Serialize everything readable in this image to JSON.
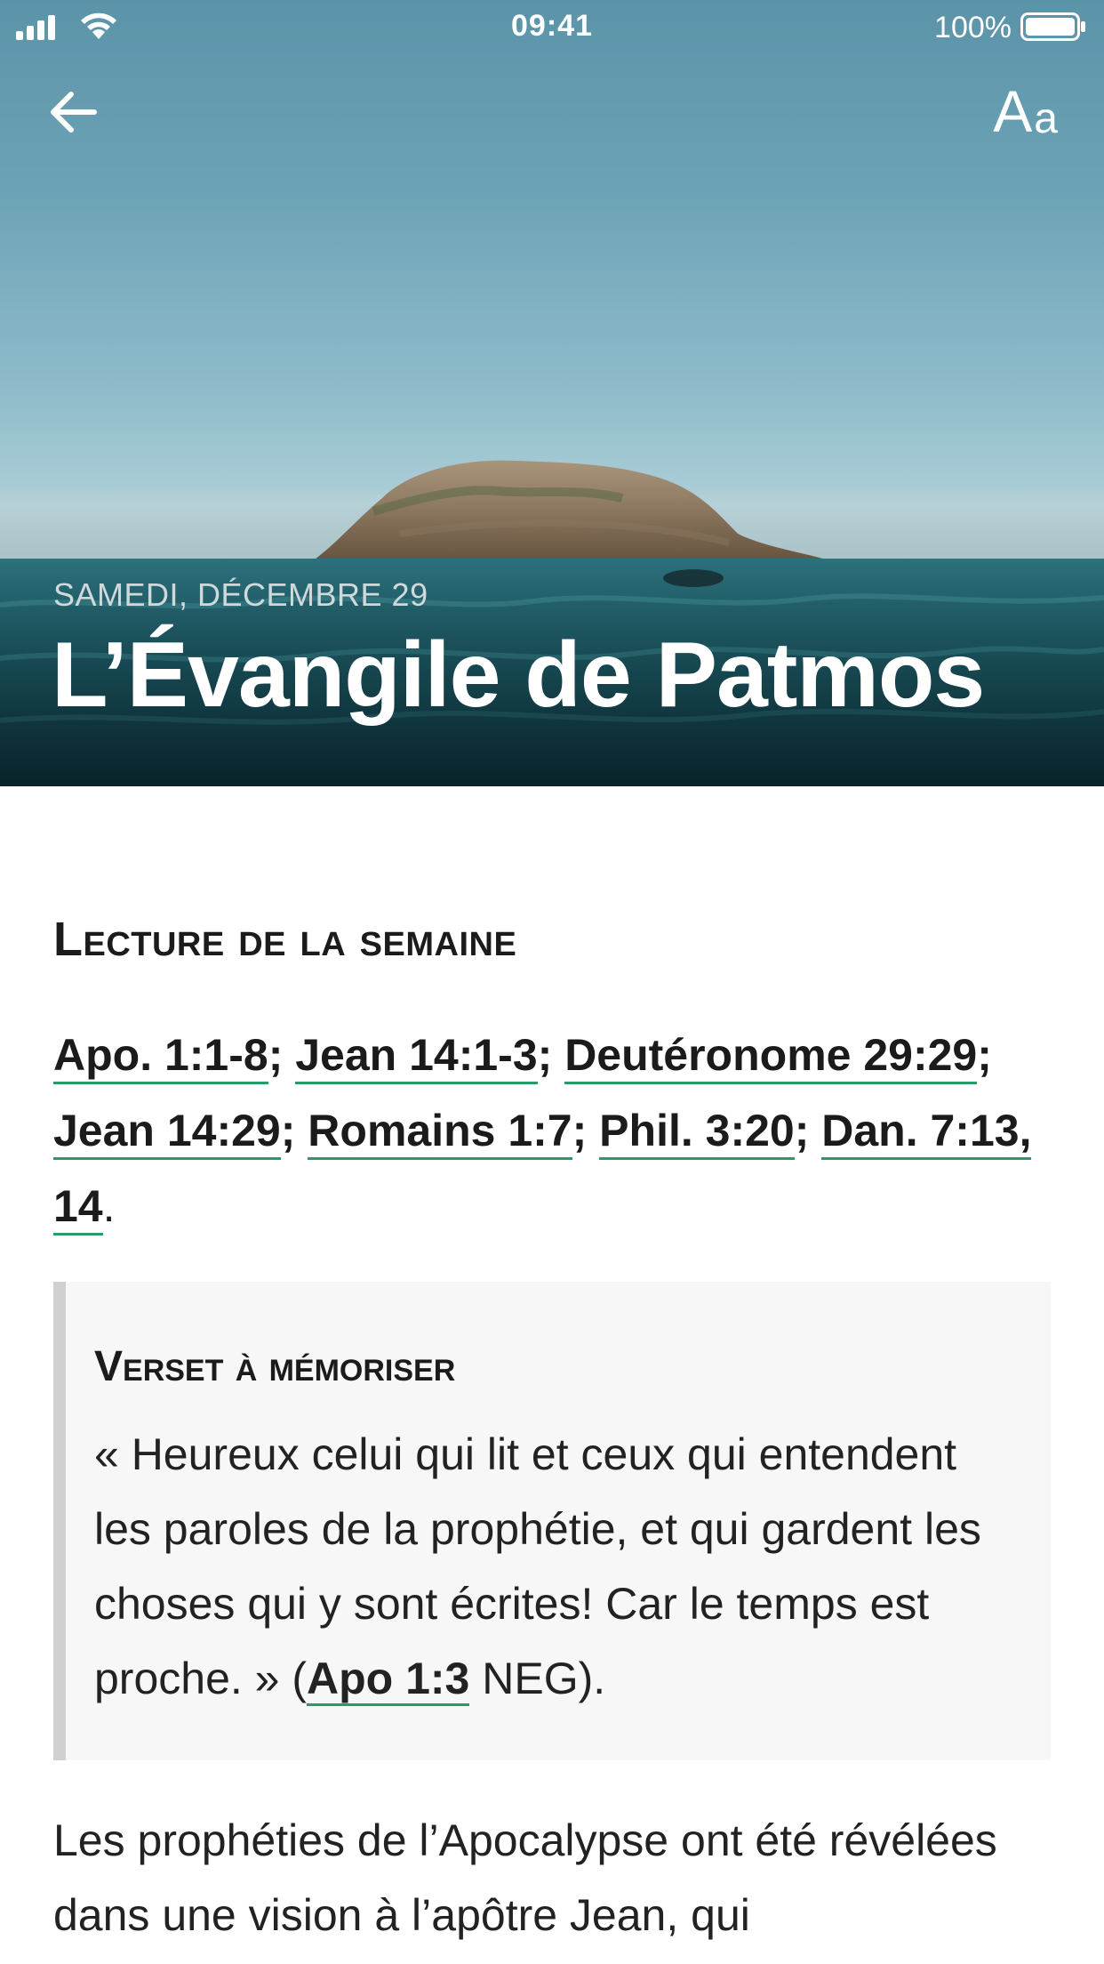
{
  "status_bar": {
    "time": "09:41",
    "battery_percent": "100%",
    "icons": [
      "signal-icon",
      "wifi-icon",
      "battery-icon"
    ]
  },
  "nav": {
    "back_icon": "back-arrow-icon",
    "font_size_big": "A",
    "font_size_small": "a"
  },
  "hero": {
    "date": "SAMEDI, DÉCEMBRE 29",
    "title": "L’Évangile de Patmos"
  },
  "reading": {
    "heading": "Lecture de la semaine",
    "references": [
      "Apo. 1:1-8",
      "Jean 14:1-3",
      "Deutéronome 29:29",
      "Jean 14:29",
      "Romains 1:7",
      "Phil. 3:20",
      "Dan. 7:13, 14"
    ],
    "separator": "; ",
    "end": "."
  },
  "memory_verse": {
    "heading": "Verset à mémoriser",
    "text": "« Heureux celui qui lit et ceux qui entendent les paroles de la prophétie, et qui gardent les choses qui y sont écrites! Car le temps est proche. » (",
    "reference": "Apo 1:3",
    "version_suffix": " NEG)."
  },
  "body": {
    "paragraph": "Les prophéties de l’Apocalypse ont été révélées dans une vision à l’apôtre Jean, qui"
  },
  "colors": {
    "link_underline": "#2a9a66",
    "memo_bg": "#f7f7f7",
    "memo_border": "#d0d0d0"
  }
}
